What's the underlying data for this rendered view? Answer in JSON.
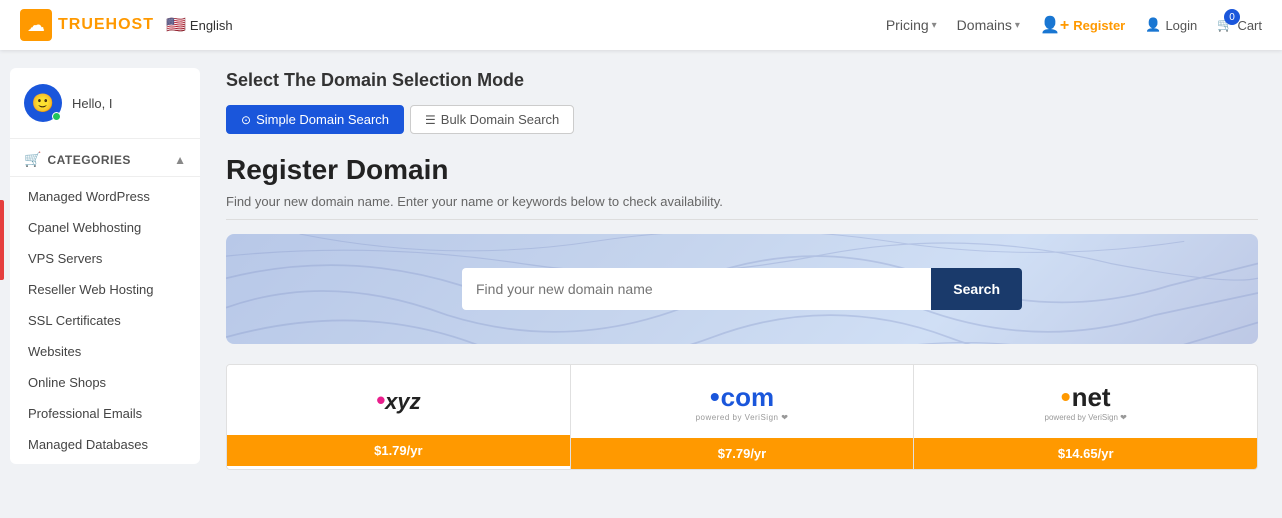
{
  "header": {
    "logo_text": "TRUEHOST",
    "logo_icon": "☁",
    "lang_flag": "🇺🇸",
    "lang_label": "English",
    "nav": [
      {
        "label": "Pricing",
        "has_arrow": true
      },
      {
        "label": "Domains",
        "has_arrow": true
      }
    ],
    "register_label": "Register",
    "login_label": "Login",
    "cart_label": "Cart",
    "cart_count": "0"
  },
  "sidebar": {
    "user_greeting": "Hello, I",
    "categories_label": "CATEGORIES",
    "menu_items": [
      "Managed WordPress",
      "Cpanel Webhosting",
      "VPS Servers",
      "Reseller Web Hosting",
      "SSL Certificates",
      "Websites",
      "Online Shops",
      "Professional Emails",
      "Managed Databases"
    ]
  },
  "main": {
    "section_title": "Select The Domain Selection Mode",
    "tab_simple": "Simple Domain Search",
    "tab_bulk": "Bulk Domain Search",
    "register_title": "Register Domain",
    "register_subtitle": "Find your new domain name. Enter your name or keywords below to check availability.",
    "search_placeholder": "Find your new domain name",
    "search_btn": "Search",
    "domain_cards": [
      {
        "name": ".xyz",
        "price": "$1.79/yr"
      },
      {
        "name": ".com",
        "price": "$7.79/yr"
      },
      {
        "name": ".net",
        "price": "$14.65/yr"
      }
    ]
  }
}
